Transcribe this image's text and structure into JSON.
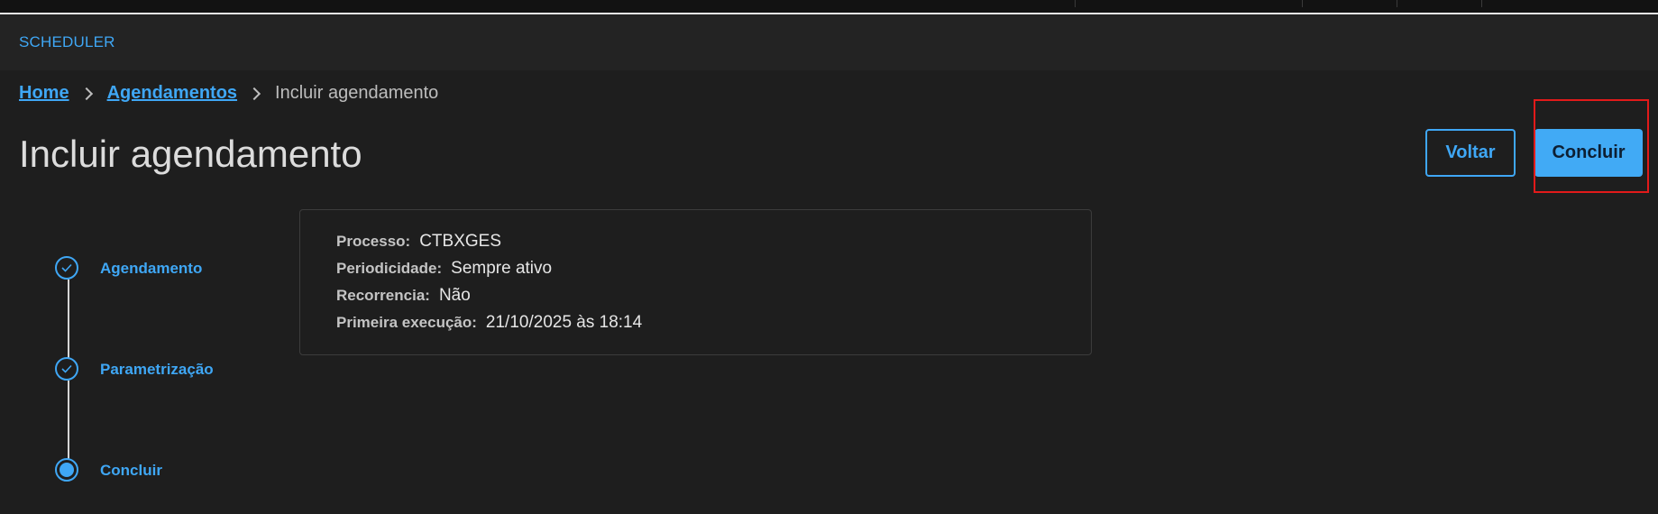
{
  "app": {
    "brand": "SCHEDULER"
  },
  "breadcrumb": {
    "home": "Home",
    "agendamentos": "Agendamentos",
    "current": "Incluir agendamento"
  },
  "page": {
    "title": "Incluir agendamento"
  },
  "actions": {
    "back_label": "Voltar",
    "finish_label": "Concluir"
  },
  "stepper": {
    "steps": [
      {
        "label": "Agendamento",
        "state": "done"
      },
      {
        "label": "Parametrização",
        "state": "done"
      },
      {
        "label": "Concluir",
        "state": "active"
      }
    ]
  },
  "summary": {
    "rows": [
      {
        "key": "Processo:",
        "value": "CTBXGES"
      },
      {
        "key": "Periodicidade:",
        "value": "Sempre ativo"
      },
      {
        "key": "Recorrencia:",
        "value": "Não"
      },
      {
        "key": "Primeira execução:",
        "value": "21/10/2025 às 18:14"
      }
    ]
  },
  "colors": {
    "accent": "#3fa7f5",
    "background": "#1e1e1e",
    "highlight": "#e21a1a"
  }
}
